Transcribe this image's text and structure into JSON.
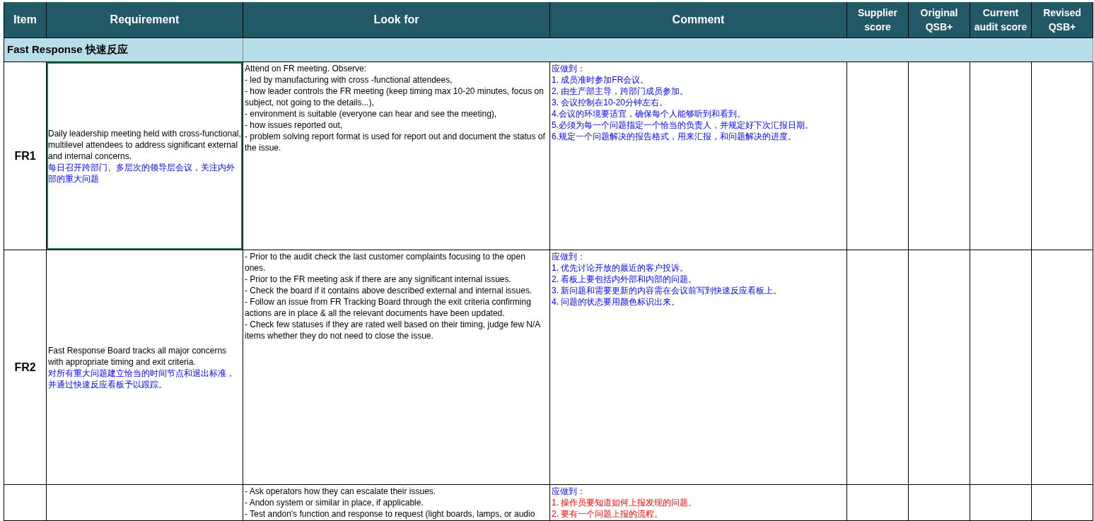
{
  "columns": [
    "Item",
    "Requirement",
    "Look for",
    "Comment",
    "Supplier score",
    "Original QSB+",
    "Current audit score",
    "Revised QSB+"
  ],
  "section": {
    "title": "Fast Response 快速反应"
  },
  "rows": [
    {
      "item": "FR1",
      "requirement_en": "Daily leadership meeting held with cross-functional, multilevel attendees to address significant external and internal concerns.",
      "requirement_zh": "每日召开跨部门、多层次的领导层会议，关注内外部的重大问题",
      "selected": true,
      "look_for": [
        "Attend on FR meeting. Observe:",
        "- led by manufacturing with cross -functional attendees,",
        "-  how leader controls the FR meeting (keep timing max 10-20 minutes, focus on subject, not going to the details...),",
        "- environment is suitable (everyone can hear and see the meeting),",
        "- how issues reported out,",
        "- problem solving report format is used for report out and document the status of the issue."
      ],
      "comment": [
        {
          "text": "应做到：",
          "kind": "note"
        },
        {
          "text": "1. 成员准时参加FR会议。",
          "kind": "note"
        },
        {
          "text": "2. 由生产部主导，跨部门成员参加。",
          "kind": "note"
        },
        {
          "text": "3. 会议控制在10-20分钟左右。",
          "kind": "note"
        },
        {
          "text": "4.会议的环境要适宜，确保每个人能够听到和看到。",
          "kind": "note"
        },
        {
          "text": "5.必须为每一个问题指定一个恰当的负责人，并规定好下次汇报日期。",
          "kind": "note"
        },
        {
          "text": "6.规定一个问题解决的报告格式，用来汇报，和问题解决的进度。",
          "kind": "note"
        }
      ]
    },
    {
      "item": "FR2",
      "requirement_en": "Fast Response Board tracks all major concerns with appropriate timing and exit criteria.",
      "requirement_zh": "对所有重大问题建立恰当的时间节点和退出标准，并通过快速反应看板予以跟踪。",
      "selected": false,
      "look_for": [
        "- Prior to the audit check the last customer complaints focusing to the open ones.",
        "- Prior to the FR meeting ask if there are any significant internal issues.",
        "- Check the board if it contains above described external and internal issues.",
        "- Follow an issue from FR Tracking Board through the exit criteria confirming actions are in place & all the relevant documents have been updated.",
        "- Check few statuses if they are rated well based on their timing, judge few N/A items whether they do not need to close the issue."
      ],
      "comment": [
        {
          "text": "应做到：",
          "kind": "note"
        },
        {
          "text": "1.  优先讨论开放的最近的客户投诉。",
          "kind": "note"
        },
        {
          "text": "2. 看板上要包括内外部和内部的问题。",
          "kind": "note"
        },
        {
          "text": "3. 新问题和需要更新的内容需在会议前写到快速反应看板上。",
          "kind": "note"
        },
        {
          "text": "4. 问题的状态要用颜色标识出来。",
          "kind": "note"
        }
      ]
    },
    {
      "selected": false,
      "look_for": [
        "- Ask operators how they can escalate their issues.",
        "- Andon system or similar in place, if applicable.",
        "- Test andon's function and response to request (light boards, lamps, or audio"
      ],
      "comment": [
        {
          "text": "应做到：",
          "kind": "note"
        },
        {
          "text": "1. 操作员要知道如何上报发现的问题。",
          "kind": "alert"
        },
        {
          "text": "2. 要有一个问题上报的流程。",
          "kind": "alert"
        }
      ]
    }
  ]
}
